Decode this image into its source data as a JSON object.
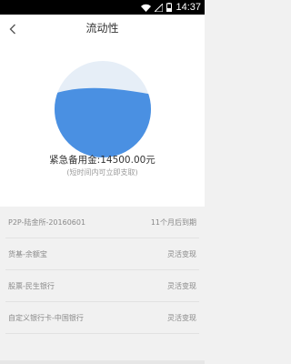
{
  "status_bar": {
    "time": "14:37",
    "icons": [
      "wifi-icon",
      "signal-icon",
      "battery-icon"
    ]
  },
  "nav": {
    "title": "流动性",
    "back_icon": "chevron-left-icon"
  },
  "gauge": {
    "fill_fraction": 0.7,
    "colors": {
      "liquid": "#4a90e2",
      "empty": "#e6eef7"
    }
  },
  "summary": {
    "amount_text": "紧急备用金:14500.00元",
    "note": "(短时间内可立即支取)"
  },
  "assets": [
    {
      "name": "P2P-陆金所-20160601",
      "status": "11个月后到期"
    },
    {
      "name": "货基-余额宝",
      "status": "灵活变现"
    },
    {
      "name": "股票-民生银行",
      "status": "灵活变现"
    },
    {
      "name": "自定义银行卡-中国银行",
      "status": "灵活变现"
    }
  ]
}
